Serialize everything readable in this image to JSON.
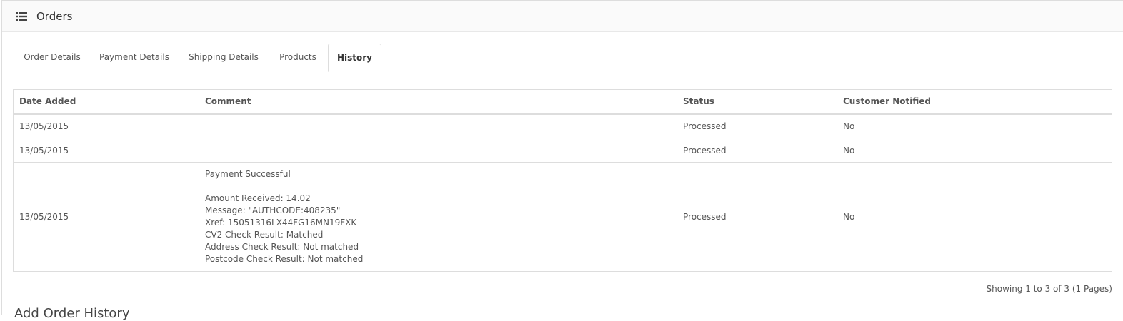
{
  "panel": {
    "title": "Orders",
    "icon": "list-icon"
  },
  "tabs": [
    {
      "label": "Order Details",
      "active": false
    },
    {
      "label": "Payment Details",
      "active": false
    },
    {
      "label": "Shipping Details",
      "active": false
    },
    {
      "label": "Products",
      "active": false
    },
    {
      "label": "History",
      "active": true
    }
  ],
  "history_table": {
    "headers": [
      "Date Added",
      "Comment",
      "Status",
      "Customer Notified"
    ],
    "rows": [
      {
        "date": "13/05/2015",
        "comment": [],
        "status": "Processed",
        "notified": "No"
      },
      {
        "date": "13/05/2015",
        "comment": [],
        "status": "Processed",
        "notified": "No"
      },
      {
        "date": "13/05/2015",
        "comment": [
          "Payment Successful",
          "",
          "Amount Received: 14.02",
          "Message: \"AUTHCODE:408235\"",
          "Xref: 15051316LX44FG16MN19FXK",
          "CV2 Check Result: Matched",
          "Address Check Result: Not matched",
          "Postcode Check Result: Not matched"
        ],
        "status": "Processed",
        "notified": "No"
      }
    ]
  },
  "pagination": {
    "text": "Showing 1 to 3 of 3 (1 Pages)"
  },
  "add_history": {
    "heading": "Add Order History"
  },
  "colors": {
    "border": "#dddddd",
    "heading_bg": "#fafafa",
    "text": "#555555"
  }
}
